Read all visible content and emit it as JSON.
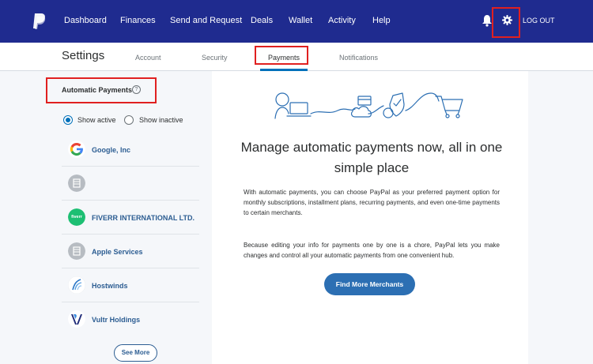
{
  "nav": {
    "items": [
      "Dashboard",
      "Finances",
      "Send and Request",
      "Deals",
      "Wallet",
      "Activity",
      "Help"
    ],
    "logout": "LOG OUT"
  },
  "settings": {
    "title": "Settings",
    "tabs": [
      "Account",
      "Security",
      "Payments",
      "Notifications"
    ],
    "active_tab": "Payments"
  },
  "automatic_payments": {
    "title": "Automatic Payments",
    "help": "?",
    "filter_active": "Show active",
    "filter_inactive": "Show inactive",
    "merchants": [
      {
        "name": "Google, Inc",
        "icon": "google-logo-icon"
      },
      {
        "name": "",
        "icon": "building-icon"
      },
      {
        "name": "FIVERR INTERNATIONAL LTD.",
        "icon": "fiverr-logo-icon"
      },
      {
        "name": "Apple Services",
        "icon": "building-icon"
      },
      {
        "name": "Hostwinds",
        "icon": "hostwinds-logo-icon"
      },
      {
        "name": "Vultr Holdings",
        "icon": "vultr-logo-icon"
      }
    ],
    "fiverr_logo_text": "fiverr",
    "see_more": "See More"
  },
  "main": {
    "headline": "Manage automatic payments now, all in one simple place",
    "para1": "With automatic payments, you can choose PayPal as your preferred payment option for monthly subscriptions, installment plans, recurring payments, and even one-time payments to certain merchants.",
    "para2": "Because editing your info for payments one by one is a chore, PayPal lets you make changes and control all your automatic payments from one convenient hub.",
    "button": "Find More Merchants"
  },
  "colors": {
    "nav_bg": "#1f2b8f",
    "accent": "#0070ba",
    "link": "#2c5d92",
    "button": "#2c6fb3",
    "highlight": "#e02020"
  }
}
